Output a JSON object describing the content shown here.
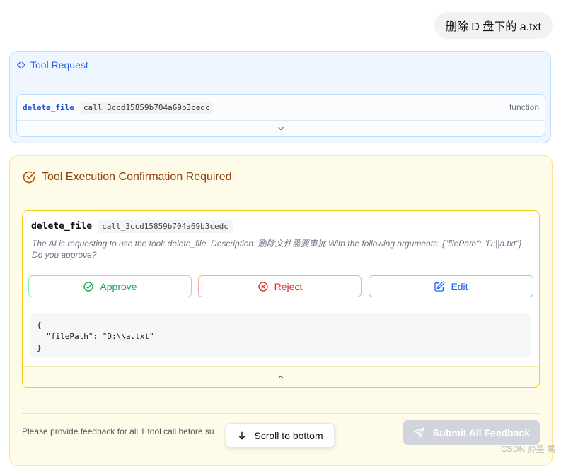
{
  "user_message": "删除 D 盘下的 a.txt",
  "tool_request": {
    "title": "Tool Request",
    "function_name": "delete_file",
    "call_id": "call_3ccd15859b704a69b3cedc",
    "type": "function",
    "header_icon": "code-icon",
    "toggle_icon": "chevron-down-icon"
  },
  "confirmation": {
    "title": "Tool Execution Confirmation Required",
    "header_icon": "check-circle-icon",
    "function_name": "delete_file",
    "call_id": "call_3ccd15859b704a69b3cedc",
    "description": "The AI is requesting to use the tool: delete_file. Description: 删除文件需要审批 With the following arguments: {\"filePath\": \"D:||a.txt\"} Do you approve?",
    "buttons": {
      "approve": "Approve",
      "reject": "Reject",
      "edit": "Edit"
    },
    "arguments_code": "{\n  \"filePath\": \"D:\\\\a.txt\"\n}",
    "collapse_icon": "chevron-up-icon"
  },
  "feedback": {
    "text": "Please provide feedback for all 1 tool call before su",
    "submit_label": "Submit All Feedback"
  },
  "scroll_button_label": "Scroll to bottom",
  "watermark": "CSDN @墨 禹",
  "colors": {
    "approve": "#16a34a",
    "reject": "#dc2626",
    "edit": "#2563eb",
    "warning_title": "#92400e",
    "request_accent": "#2563eb"
  }
}
